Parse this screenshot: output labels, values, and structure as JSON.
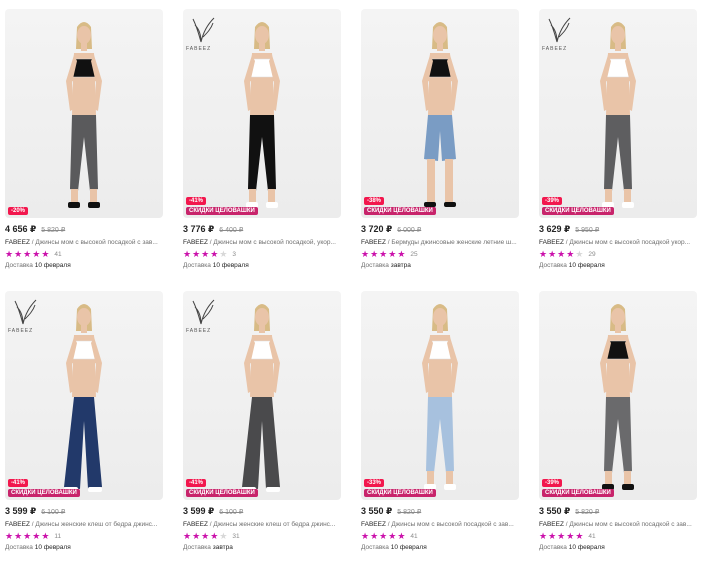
{
  "colors": {
    "rating_star": "#cb11ab",
    "discount_badge": "#f2174d",
    "promo_badge": "#c8246b"
  },
  "products": [
    {
      "price": "4 656 ₽",
      "old_price": "5 820 ₽",
      "brand": "FABEEZ",
      "title": " / Джинсы мом с высокой посадкой с зав...",
      "rating": 5,
      "reviews": "41",
      "delivery_label": "Доставка",
      "delivery_date": "10 февраля",
      "discount": "-20%",
      "promo": "",
      "logo": false,
      "top_color": "#111111",
      "jeans_color": "#5a5a5c",
      "shape": "tapered"
    },
    {
      "price": "3 776 ₽",
      "old_price": "6 400 ₽",
      "brand": "FABEEZ",
      "title": " / Джинсы мом с высокой посадкой, укор...",
      "rating": 4,
      "reviews": "3",
      "delivery_label": "Доставка",
      "delivery_date": "10 февраля",
      "discount": "-41%",
      "promo": "СКИДКИ ЦЕЛОВАШКИ",
      "logo": true,
      "top_color": "#ffffff",
      "jeans_color": "#111111",
      "shape": "tapered"
    },
    {
      "price": "3 720 ₽",
      "old_price": "6 000 ₽",
      "brand": "FABEEZ",
      "title": " / Бермуды джинсовые женские летние ш...",
      "rating": 5,
      "reviews": "25",
      "delivery_label": "Доставка",
      "delivery_date": "завтра",
      "discount": "-38%",
      "promo": "СКИДКИ ЦЕЛОВАШКИ",
      "logo": false,
      "top_color": "#111111",
      "jeans_color": "#7a9cc4",
      "shape": "shorts"
    },
    {
      "price": "3 629 ₽",
      "old_price": "5 950 ₽",
      "brand": "FABEEZ",
      "title": " / Джинсы мом с высокой посадкой укор...",
      "rating": 4,
      "reviews": "29",
      "delivery_label": "Доставка",
      "delivery_date": "10 февраля",
      "discount": "-39%",
      "promo": "СКИДКИ ЦЕЛОВАШКИ",
      "logo": true,
      "top_color": "#ffffff",
      "jeans_color": "#5e5e60",
      "shape": "tapered"
    },
    {
      "price": "3 599 ₽",
      "old_price": "6 100 ₽",
      "brand": "FABEEZ",
      "title": " / Джинсы женские клеш от бедра джинс...",
      "rating": 5,
      "reviews": "11",
      "delivery_label": "Доставка",
      "delivery_date": "10 февраля",
      "discount": "-41%",
      "promo": "СКИДКИ ЦЕЛОВАШКИ",
      "logo": true,
      "top_color": "#ffffff",
      "jeans_color": "#22396a",
      "shape": "wide"
    },
    {
      "price": "3 599 ₽",
      "old_price": "6 100 ₽",
      "brand": "FABEEZ",
      "title": " / Джинсы женские клеш от бедра джинс...",
      "rating": 4,
      "reviews": "31",
      "delivery_label": "Доставка",
      "delivery_date": "завтра",
      "discount": "-41%",
      "promo": "СКИДКИ ЦЕЛОВАШКИ",
      "logo": true,
      "top_color": "#ffffff",
      "jeans_color": "#4a4a4c",
      "shape": "wide"
    },
    {
      "price": "3 550 ₽",
      "old_price": "5 820 ₽",
      "brand": "FABEEZ",
      "title": " / Джинсы мом с высокой посадкой с зав...",
      "rating": 5,
      "reviews": "41",
      "delivery_label": "Доставка",
      "delivery_date": "10 февраля",
      "discount": "-33%",
      "promo": "СКИДКИ ЦЕЛОВАШКИ",
      "logo": false,
      "top_color": "#ffffff",
      "jeans_color": "#a7c1de",
      "shape": "tapered"
    },
    {
      "price": "3 550 ₽",
      "old_price": "5 820 ₽",
      "brand": "FABEEZ",
      "title": " / Джинсы мом с высокой посадкой с зав...",
      "rating": 5,
      "reviews": "41",
      "delivery_label": "Доставка",
      "delivery_date": "10 февраля",
      "discount": "-39%",
      "promo": "СКИДКИ ЦЕЛОВАШКИ",
      "logo": false,
      "top_color": "#111111",
      "jeans_color": "#6a6a6c",
      "shape": "tapered"
    }
  ]
}
